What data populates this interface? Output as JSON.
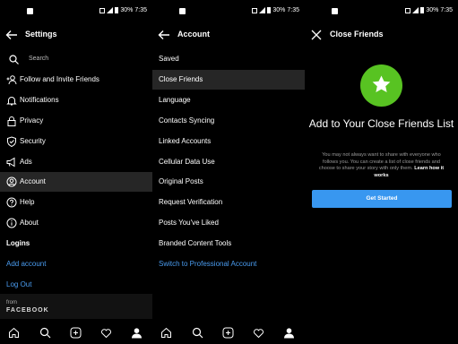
{
  "status": {
    "battery": "30%",
    "time": "7:35"
  },
  "settings": {
    "title": "Settings",
    "search_placeholder": "Search",
    "items": [
      {
        "label": "Follow and Invite Friends",
        "icon": "add-person-icon"
      },
      {
        "label": "Notifications",
        "icon": "bell-icon"
      },
      {
        "label": "Privacy",
        "icon": "lock-icon"
      },
      {
        "label": "Security",
        "icon": "shield-icon"
      },
      {
        "label": "Ads",
        "icon": "megaphone-icon"
      },
      {
        "label": "Account",
        "icon": "account-circle-icon"
      },
      {
        "label": "Help",
        "icon": "help-icon"
      },
      {
        "label": "About",
        "icon": "info-icon"
      }
    ],
    "logins_header": "Logins",
    "add_account": "Add account",
    "log_out": "Log Out",
    "from": "from",
    "facebook": "FACEBOOK"
  },
  "account": {
    "title": "Account",
    "items": [
      "Saved",
      "Close Friends",
      "Language",
      "Contacts Syncing",
      "Linked Accounts",
      "Cellular Data Use",
      "Original Posts",
      "Request Verification",
      "Posts You've Liked",
      "Branded Content Tools"
    ],
    "switch_label": "Switch to Professional Account"
  },
  "close_friends": {
    "title": "Close Friends",
    "heading": "Add to Your Close Friends List",
    "body": "You may not always want to share with everyone who follows you. You can create a list of close friends and choose to share your story with only them.",
    "link": "Learn how it works",
    "button": "Get Started"
  },
  "colors": {
    "accent": "#3897f0",
    "link": "#4a9cf0",
    "star_bg": "#58c322",
    "selected_row": "#262626"
  }
}
